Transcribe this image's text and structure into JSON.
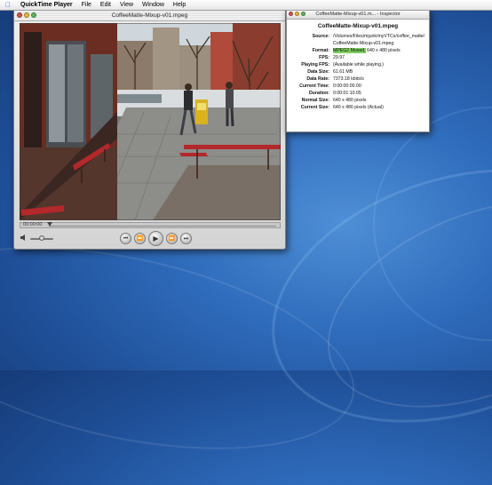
{
  "menubar": {
    "items": [
      "QuickTime Player",
      "File",
      "Edit",
      "View",
      "Window",
      "Help"
    ]
  },
  "player": {
    "title": "CoffeeMatte-Mixup-v01.mpeg",
    "current_time": "00:00:00"
  },
  "inspector": {
    "title": "CoffeeMatte-Mixup-v01.m... - Inspector",
    "file_name": "CoffeeMatte-Mixup-v01.mpeg",
    "source_label": "Source:",
    "source_value": "/Volumes/Files/mjunk/myVTCs/coffee_matte/CoffeeMatte-Mixup-v01.mpeg",
    "format_label": "Format:",
    "format_highlight": "MPEG2 Muxed,",
    "format_rest": " 640 x 480 pixels",
    "fps_label": "FPS:",
    "fps_value": "29.97",
    "playing_fps_label": "Playing FPS:",
    "playing_fps_value": "(Available while playing.)",
    "data_size_label": "Data Size:",
    "data_size_value": "61.61 MB",
    "data_rate_label": "Data Rate:",
    "data_rate_value": "7373.18 kbits/s",
    "current_time_label": "Current Time:",
    "current_time_value": "0:00:00:00.00",
    "duration_label": "Duration:",
    "duration_value": "0:00:01:10.05",
    "normal_size_label": "Normal Size:",
    "normal_size_value": "640 x 480 pixels",
    "current_size_label": "Current Size:",
    "current_size_value": "640 x 480 pixels (Actual)"
  },
  "colors": {
    "format_highlight": "#7fcf5f",
    "desktop": "#2f6cbc"
  }
}
